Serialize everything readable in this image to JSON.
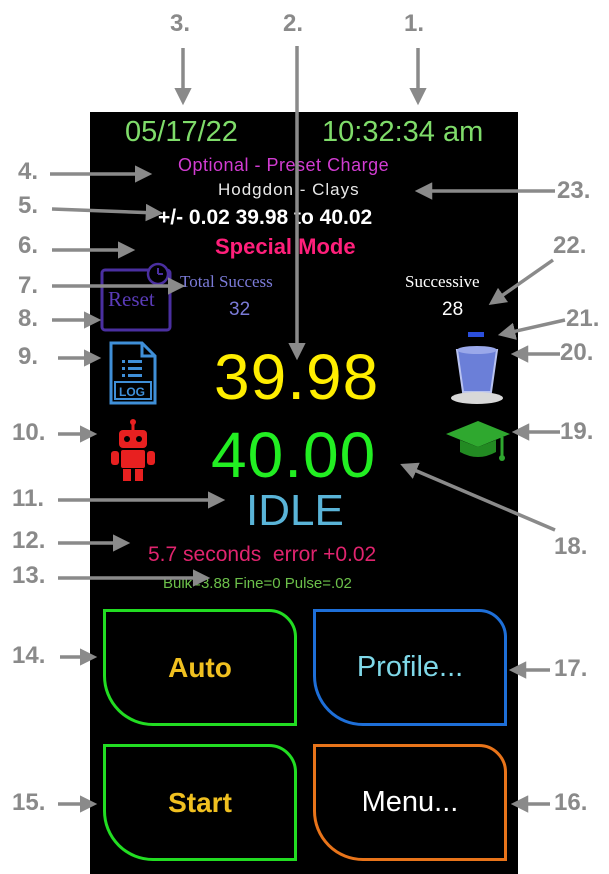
{
  "status_bar": {
    "date": "05/17/22",
    "time": "10:32:34 am"
  },
  "preset": {
    "optional_label": "Optional - Preset Charge",
    "powder": "Hodgdon - Clays",
    "tolerance": "+/- 0.02 39.98 to 40.02",
    "mode": "Special Mode"
  },
  "stats": {
    "total_success_label": "Total Success",
    "total_success_value": "32",
    "successive_label": "Successive",
    "successive_value": "28",
    "reset_label": "Reset",
    "log_label": "LOG"
  },
  "readings": {
    "current_weight": "39.98",
    "target_weight": "40.00",
    "state": "IDLE"
  },
  "info": {
    "error_line": "5.7 seconds  error +0.02",
    "settings_line": "Bulk=3.88 Fine=0 Pulse=.02"
  },
  "buttons": {
    "auto": "Auto",
    "profile": "Profile...",
    "start": "Start",
    "menu": "Menu..."
  },
  "callouts": [
    "1.",
    "2.",
    "3.",
    "4.",
    "5.",
    "6.",
    "7.",
    "8.",
    "9.",
    "10.",
    "11.",
    "12.",
    "13.",
    "14.",
    "15.",
    "16.",
    "17.",
    "18.",
    "19.",
    "20.",
    "21.",
    "22.",
    "23."
  ],
  "colors": {
    "date_time": "#7fdc6a",
    "optional": "#d23cd2",
    "mode": "#ff1f7a",
    "current": "#ffee00",
    "target": "#22ee22",
    "idle": "#5ab4d8",
    "error": "#e0246e",
    "settings": "#6cc04a",
    "auto_border": "#22dd22",
    "profile_border": "#1e6fd8",
    "start_border": "#22dd22",
    "menu_border": "#e8741a"
  },
  "icons": [
    "reset-icon",
    "log-file-icon",
    "robot-icon",
    "cup-icon",
    "graduation-cap-icon"
  ]
}
